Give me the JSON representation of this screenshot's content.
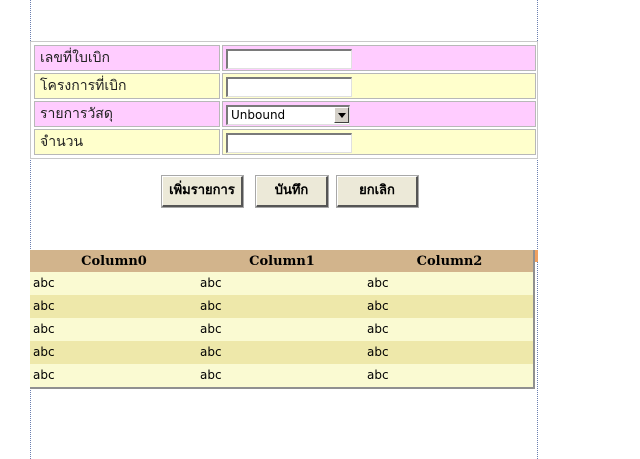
{
  "form": {
    "fields": [
      {
        "label": "เลขที่ใบเบิก",
        "value": ""
      },
      {
        "label": "โครงการที่เบิก",
        "value": ""
      },
      {
        "label": "รายการวัสดุ",
        "value": "Unbound"
      },
      {
        "label": "จำนวน",
        "value": ""
      }
    ]
  },
  "buttons": {
    "add_label": "เพิ่มรายการ",
    "save_label": "บันทึก",
    "cancel_label": "ยกเลิก"
  },
  "grid": {
    "columns": [
      "Column0",
      "Column1",
      "Column2"
    ],
    "rows": [
      [
        "abc",
        "abc",
        "abc"
      ],
      [
        "abc",
        "abc",
        "abc"
      ],
      [
        "abc",
        "abc",
        "abc"
      ],
      [
        "abc",
        "abc",
        "abc"
      ],
      [
        "abc",
        "abc",
        "abc"
      ]
    ]
  },
  "colors": {
    "label_pink": "#ffccff",
    "label_yellow": "#ffffcc",
    "grid_header": "#d2b48c",
    "row_light": "#fafad2",
    "row_dark": "#eee8aa"
  },
  "icons": {
    "dropdown": "chevron-down-icon"
  }
}
